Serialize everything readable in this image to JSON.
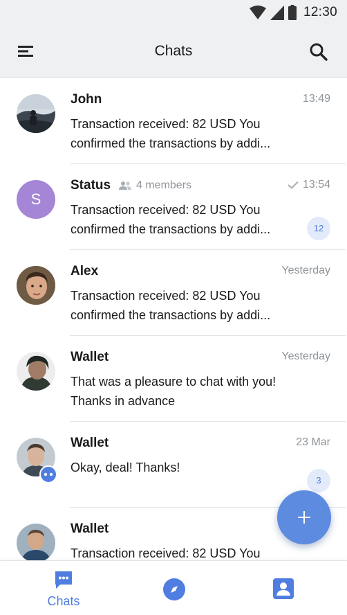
{
  "status_bar": {
    "time": "12:30",
    "icons": [
      "wifi-icon",
      "cellular-signal-icon",
      "battery-icon"
    ]
  },
  "app_bar": {
    "title": "Chats",
    "left_icon": "menu-icon",
    "right_icon": "search-icon"
  },
  "colors": {
    "accent": "#4f7de0",
    "fab": "#5c8be0",
    "status_avatar": "#a585d6",
    "muted_text": "#8f949a",
    "bar_background": "#eef0f2"
  },
  "chats": [
    {
      "name": "John",
      "time": "13:49",
      "line1": "Transaction received: 82 USD You",
      "line2": "confirmed the transactions by addi...",
      "avatar": "photo"
    },
    {
      "name": "Status",
      "members": "4 members",
      "time": "13:54",
      "read": true,
      "line1": "Transaction received: 82 USD You",
      "line2": "confirmed the transactions by addi...",
      "avatar_letter": "S",
      "unread": "12"
    },
    {
      "name": "Alex",
      "time": "Yesterday",
      "line1": "Transaction received: 82 USD You",
      "line2": "confirmed the transactions by addi...",
      "avatar": "photo"
    },
    {
      "name": "Wallet",
      "time": "Yesterday",
      "line1": "That was a pleasure to chat with you!",
      "line2": "Thanks in advance",
      "avatar": "photo"
    },
    {
      "name": "Wallet",
      "time": "23 Mar",
      "line1": "Okay, deal! Thanks!",
      "line2": "",
      "avatar": "photo",
      "unread": "3",
      "online_badge": true
    },
    {
      "name": "Wallet",
      "time": "",
      "line1": "Transaction received: 82 USD You",
      "line2": "",
      "avatar": "photo"
    }
  ],
  "fab": {
    "icon": "plus-icon"
  },
  "bottom_nav": [
    {
      "label": "Chats",
      "icon": "chat-bubble-icon",
      "active": true
    },
    {
      "label": "",
      "icon": "compass-icon"
    },
    {
      "label": "",
      "icon": "contact-card-icon"
    }
  ]
}
